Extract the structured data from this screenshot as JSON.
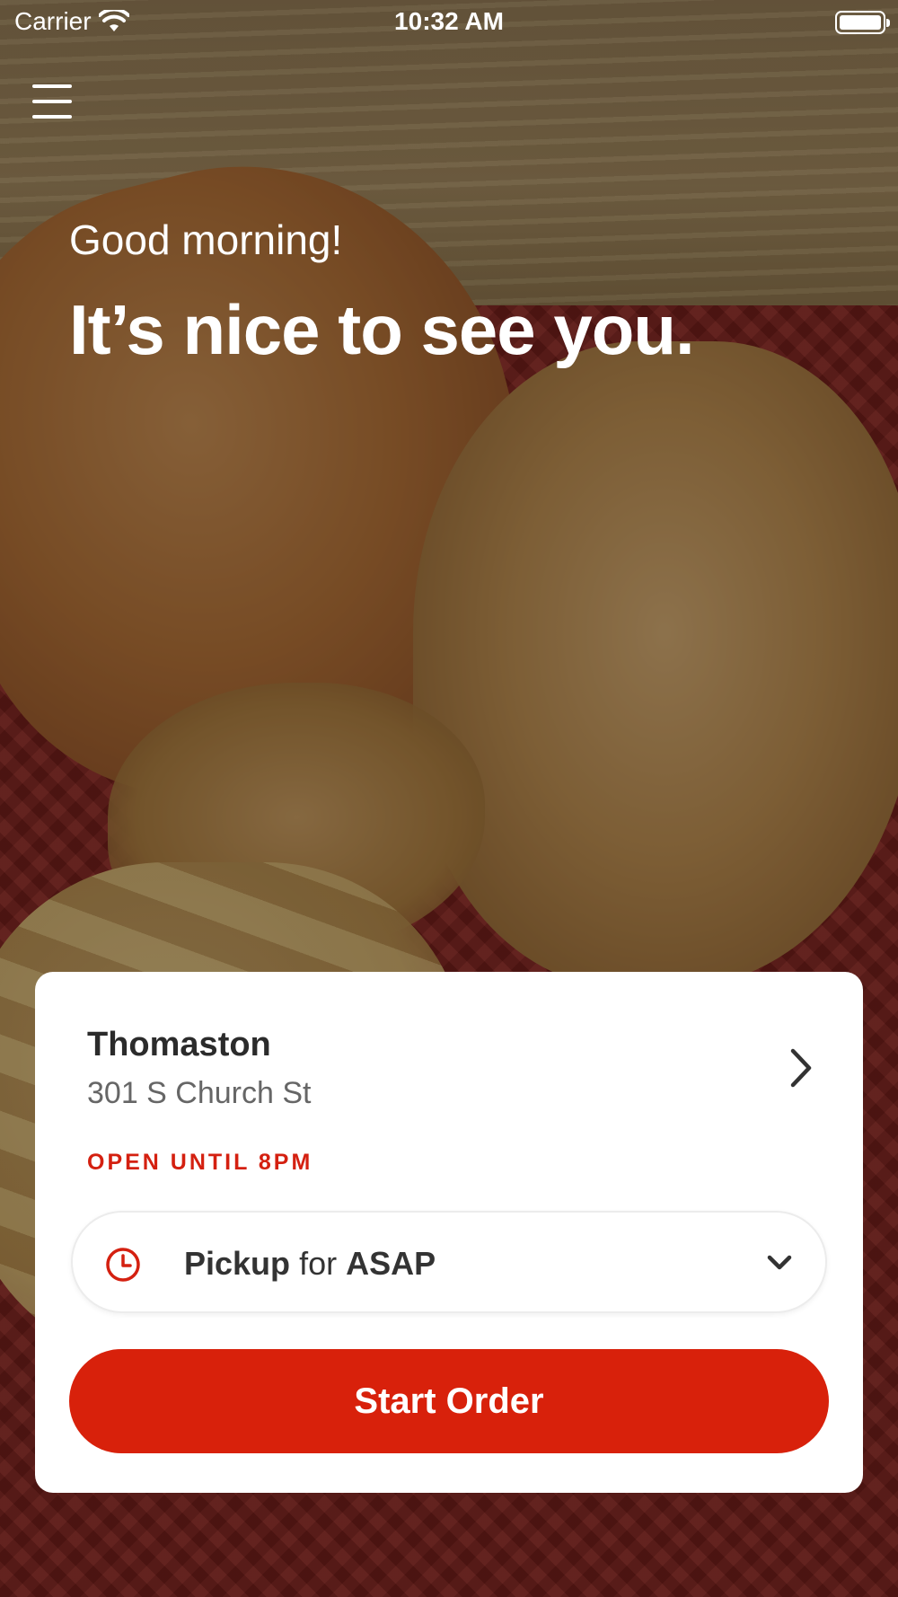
{
  "status_bar": {
    "carrier": "Carrier",
    "time": "10:32 AM"
  },
  "greeting": "Good morning!",
  "headline": "It’s nice to see you.",
  "store": {
    "name": "Thomaston",
    "address": "301 S Church St",
    "hours_status": "OPEN UNTIL 8PM"
  },
  "order_mode": {
    "mode": "Pickup",
    "connector": "for",
    "time": "ASAP"
  },
  "start_order_label": "Start Order",
  "colors": {
    "accent": "#d8210b",
    "status_red": "#d42010",
    "text_dark": "#2b2b2b",
    "text_muted": "#666666"
  },
  "icons": {
    "menu": "hamburger-menu-icon",
    "wifi": "wifi-icon",
    "battery": "battery-icon",
    "store_nav": "chevron-right-icon",
    "clock": "clock-icon",
    "dropdown": "chevron-down-icon"
  }
}
